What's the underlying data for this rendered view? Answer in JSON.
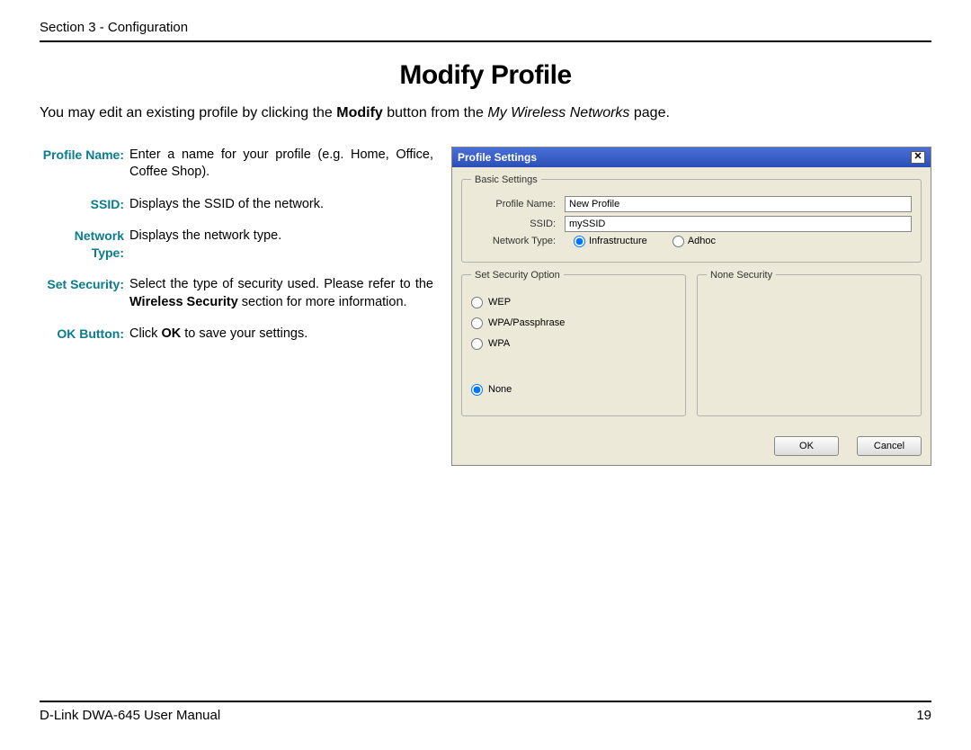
{
  "header": {
    "section": "Section 3 - Configuration"
  },
  "title": "Modify Profile",
  "intro": {
    "pre": "You may edit an existing profile by clicking the ",
    "bold": "Modify",
    "mid": " button from the ",
    "italic": "My Wireless Networks",
    "post": " page."
  },
  "defs": [
    {
      "label": "Profile Name:",
      "text": "Enter a name for your profile (e.g. Home, Office, Coffee Shop)."
    },
    {
      "label": "SSID:",
      "text": "Displays the SSID of the network."
    },
    {
      "label": "Network Type:",
      "text": "Displays the network type."
    },
    {
      "label": "Set Security:",
      "text_pre": "Select the type of security used. Please refer to the ",
      "text_bold": "Wireless Security",
      "text_post": " section for more information."
    },
    {
      "label": "OK Button:",
      "text_pre": "Click ",
      "text_bold": "OK",
      "text_post": " to save your settings."
    }
  ],
  "dialog": {
    "title": "Profile Settings",
    "basic_legend": "Basic Settings",
    "labels": {
      "profile_name": "Profile Name:",
      "ssid": "SSID:",
      "network_type": "Network Type:"
    },
    "values": {
      "profile_name": "New Profile",
      "ssid": "mySSID"
    },
    "network_types": {
      "infra": "Infrastructure",
      "adhoc": "Adhoc"
    },
    "sec_legend": "Set Security Option",
    "none_legend": "None Security",
    "sec_options": {
      "wep": "WEP",
      "wpa_pass": "WPA/Passphrase",
      "wpa": "WPA",
      "none": "None"
    },
    "buttons": {
      "ok": "OK",
      "cancel": "Cancel"
    }
  },
  "footer": {
    "left": "D-Link DWA-645 User Manual",
    "right": "19"
  }
}
